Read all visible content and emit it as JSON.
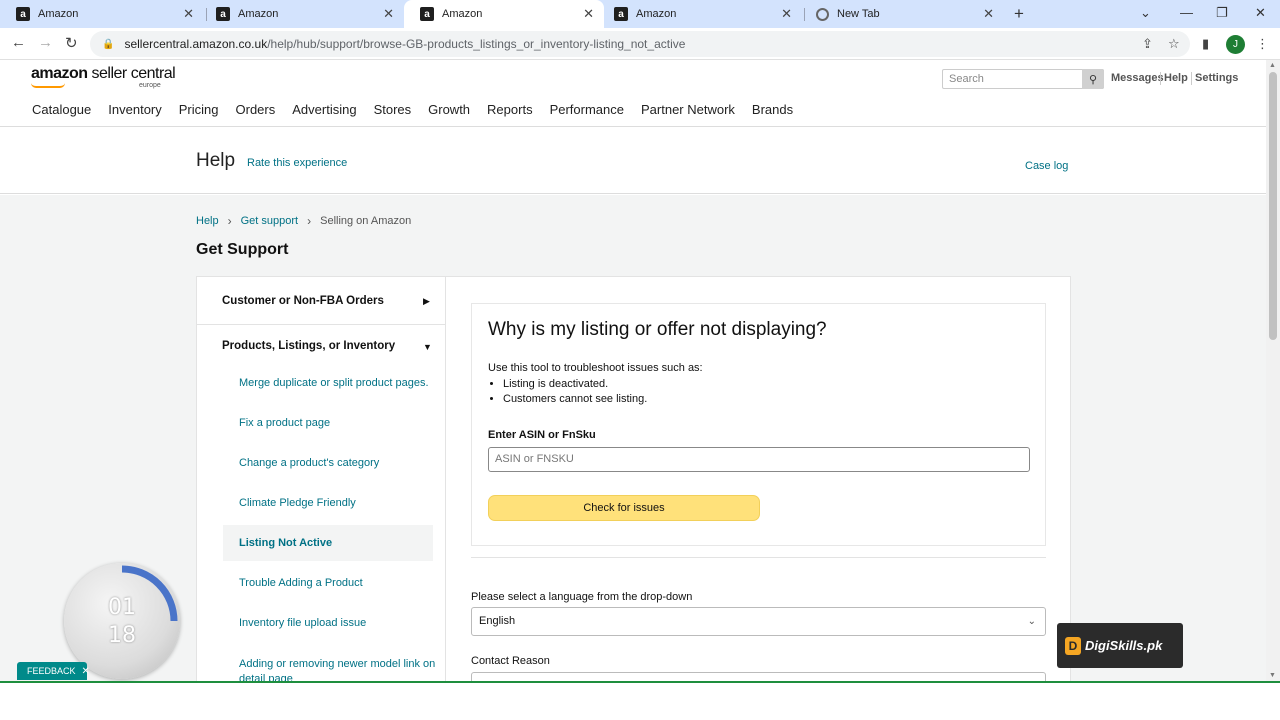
{
  "browser": {
    "tabs": [
      {
        "title": "Amazon",
        "icon": "amazon-favicon"
      },
      {
        "title": "Amazon",
        "icon": "amazon-favicon"
      },
      {
        "title": "Amazon",
        "icon": "amazon-favicon"
      },
      {
        "title": "Amazon",
        "icon": "amazon-favicon"
      },
      {
        "title": "New Tab",
        "icon": "chrome-favicon"
      }
    ],
    "url_host": "sellercentral.amazon.co.uk",
    "url_path": "/help/hub/support/browse-GB-products_listings_or_inventory-listing_not_active",
    "profile_initial": "J"
  },
  "header": {
    "logo_amazon": "amazon",
    "logo_seller": " seller central",
    "logo_region": "europe",
    "search_placeholder": "Search",
    "links": [
      "Messages",
      "Help",
      "Settings"
    ]
  },
  "nav": [
    "Catalogue",
    "Inventory",
    "Pricing",
    "Orders",
    "Advertising",
    "Stores",
    "Growth",
    "Reports",
    "Performance",
    "Partner Network",
    "Brands"
  ],
  "helpbar": {
    "title": "Help",
    "rate": "Rate this experience",
    "case_log": "Case log"
  },
  "breadcrumb": [
    "Help",
    "Get support",
    "Selling on Amazon"
  ],
  "page_title": "Get Support",
  "sidebar": {
    "categories": [
      {
        "label": "Customer or Non-FBA Orders",
        "expanded": false
      },
      {
        "label": "Products, Listings, or Inventory",
        "expanded": true
      }
    ],
    "items": [
      "Merge duplicate or split product pages.",
      "Fix a product page",
      "Change a product's category",
      "Climate Pledge Friendly",
      "Listing Not Active",
      "Trouble Adding a Product",
      "Inventory file upload issue",
      "Adding or removing newer model link on detail page"
    ],
    "active_item": "Listing Not Active"
  },
  "tool": {
    "heading": "Why is my listing or offer not displaying?",
    "intro": "Use this tool to troubleshoot issues such as:",
    "bullets": [
      "Listing is deactivated.",
      "Customers cannot see listing."
    ],
    "input_label": "Enter ASIN or FnSku",
    "input_placeholder": "ASIN or FNSKU",
    "button": "Check for issues"
  },
  "form": {
    "language_label": "Please select a language from the drop-down",
    "language_value": "English",
    "contact_label": "Contact Reason"
  },
  "overlays": {
    "timer_top": "01",
    "timer_bottom": "18",
    "feedback": "FEEDBACK",
    "brand": "DigiSkills.pk"
  }
}
